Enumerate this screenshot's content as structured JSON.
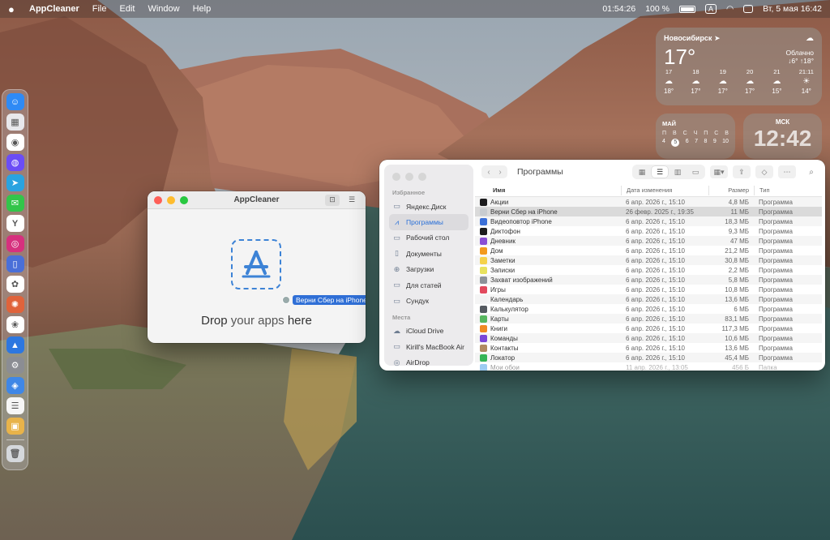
{
  "menubar": {
    "app_name": "AppCleaner",
    "items": [
      "File",
      "Edit",
      "Window",
      "Help"
    ],
    "record_time": "01:54:26",
    "battery": "100 %",
    "input_source": "A",
    "datetime": "Вт, 5 мая  16:42"
  },
  "dock": {
    "apps": [
      {
        "name": "finder-icon",
        "color": "#2f8af5",
        "glyph": "☺"
      },
      {
        "name": "launchpad-icon",
        "color": "#e8e8ec",
        "glyph": "▦"
      },
      {
        "name": "chrome-icon",
        "color": "#ffffff",
        "glyph": "◉"
      },
      {
        "name": "messenger-icon",
        "color": "#6b4df6",
        "glyph": "◍"
      },
      {
        "name": "telegram-icon",
        "color": "#2aa3e0",
        "glyph": "➤"
      },
      {
        "name": "messages-icon",
        "color": "#33c54a",
        "glyph": "✉"
      },
      {
        "name": "yandex-browser-icon",
        "color": "#ffffff",
        "glyph": "Y"
      },
      {
        "name": "instagram-icon",
        "color": "#d6307e",
        "glyph": "◎"
      },
      {
        "name": "phone-mirroring-icon",
        "color": "#4a6fd8",
        "glyph": "▯"
      },
      {
        "name": "chatgpt-icon",
        "color": "#ffffff",
        "glyph": "✿"
      },
      {
        "name": "claude-icon",
        "color": "#e0633b",
        "glyph": "✺"
      },
      {
        "name": "photos-icon",
        "color": "#ffffff",
        "glyph": "❀"
      },
      {
        "name": "keynote-icon",
        "color": "#2d77e0",
        "glyph": "▲"
      },
      {
        "name": "system-settings-icon",
        "color": "#8b8d93",
        "glyph": "⚙"
      },
      {
        "name": "cleaner-icon",
        "color": "#3f87e6",
        "glyph": "◈"
      },
      {
        "name": "notes-icon",
        "color": "#f6f6f6",
        "glyph": "☰"
      },
      {
        "name": "preview-icon",
        "color": "#e8b34a",
        "glyph": "▣"
      }
    ],
    "trash": {
      "name": "trash-icon",
      "color": "#d5d8dc",
      "glyph": "🗑"
    }
  },
  "weather": {
    "city": "Новосибирск",
    "temp": "17°",
    "condition": "Облачно",
    "range": "↓6° ↑18°",
    "hours": [
      {
        "time": "17",
        "temp": "18°",
        "icon": "☁"
      },
      {
        "time": "18",
        "temp": "17°",
        "icon": "☁"
      },
      {
        "time": "19",
        "temp": "17°",
        "icon": "☁"
      },
      {
        "time": "20",
        "temp": "17°",
        "icon": "☁"
      },
      {
        "time": "21",
        "temp": "15°",
        "icon": "☁"
      },
      {
        "time": "21:11",
        "temp": "14°",
        "icon": "☀"
      }
    ]
  },
  "calendar": {
    "month": "МАЙ",
    "weekdays": [
      "П",
      "В",
      "С",
      "Ч",
      "П",
      "С",
      "В"
    ],
    "dates": [
      "4",
      "5",
      "6",
      "7",
      "8",
      "9",
      "10"
    ],
    "today": "5"
  },
  "clock": {
    "label": "МСК",
    "time": "12:42"
  },
  "appcleaner": {
    "title": "AppCleaner",
    "drop_prefix": "Drop",
    "drop_middle": " your apps ",
    "drop_suffix": "here",
    "drag_label": "Верни Сбер на iPhone"
  },
  "finder": {
    "title": "Программы",
    "sidebar": {
      "favorites_header": "Избранное",
      "favorites": [
        {
          "label": "Яндекс.Диск",
          "icon": "folder-icon",
          "glyph": "▭"
        },
        {
          "label": "Программы",
          "icon": "applications-icon",
          "glyph": "⩘",
          "active": true
        },
        {
          "label": "Рабочий стол",
          "icon": "desktop-icon",
          "glyph": "▭"
        },
        {
          "label": "Документы",
          "icon": "document-icon",
          "glyph": "▯"
        },
        {
          "label": "Загрузки",
          "icon": "downloads-icon",
          "glyph": "⊕"
        },
        {
          "label": "Для статей",
          "icon": "folder-icon",
          "glyph": "▭"
        },
        {
          "label": "Сундук",
          "icon": "folder-icon",
          "glyph": "▭"
        }
      ],
      "locations_header": "Места",
      "locations": [
        {
          "label": "iCloud Drive",
          "icon": "icloud-icon",
          "glyph": "☁"
        },
        {
          "label": "Kirill's MacBook Air",
          "icon": "laptop-icon",
          "glyph": "▭"
        },
        {
          "label": "AirDrop",
          "icon": "airdrop-icon",
          "glyph": "◎"
        }
      ]
    },
    "columns": {
      "name": "Имя",
      "date": "Дата изменения",
      "size": "Размер",
      "kind": "Тип"
    },
    "rows": [
      {
        "name": "Акции",
        "date": "6 апр. 2026 г., 15:10",
        "size": "4,8 МБ",
        "kind": "Программа",
        "color": "#1c1c1e"
      },
      {
        "name": "Верни Сбер на iPhone",
        "date": "26 февр. 2025 г., 19:35",
        "size": "11 МБ",
        "kind": "Программа",
        "color": "#c8ccd0"
      },
      {
        "name": "Видеоповтор iPhone",
        "date": "6 апр. 2026 г., 15:10",
        "size": "18,3 МБ",
        "kind": "Программа",
        "color": "#3a6fd8"
      },
      {
        "name": "Диктофон",
        "date": "6 апр. 2026 г., 15:10",
        "size": "9,3 МБ",
        "kind": "Программа",
        "color": "#1c1c1e"
      },
      {
        "name": "Дневник",
        "date": "6 апр. 2026 г., 15:10",
        "size": "47 МБ",
        "kind": "Программа",
        "color": "#8a4fd6"
      },
      {
        "name": "Дом",
        "date": "6 апр. 2026 г., 15:10",
        "size": "21,2 МБ",
        "kind": "Программа",
        "color": "#f39a1e"
      },
      {
        "name": "Заметки",
        "date": "6 апр. 2026 г., 15:10",
        "size": "30,8 МБ",
        "kind": "Программа",
        "color": "#f5d24a"
      },
      {
        "name": "Записки",
        "date": "6 апр. 2026 г., 15:10",
        "size": "2,2 МБ",
        "kind": "Программа",
        "color": "#e8e25e"
      },
      {
        "name": "Захват изображений",
        "date": "6 апр. 2026 г., 15:10",
        "size": "5,8 МБ",
        "kind": "Программа",
        "color": "#8d9299"
      },
      {
        "name": "Игры",
        "date": "6 апр. 2026 г., 15:10",
        "size": "10,8 МБ",
        "kind": "Программа",
        "color": "#e2495d"
      },
      {
        "name": "Календарь",
        "date": "6 апр. 2026 г., 15:10",
        "size": "13,6 МБ",
        "kind": "Программа",
        "color": "#f2f2f2"
      },
      {
        "name": "Калькулятор",
        "date": "6 апр. 2026 г., 15:10",
        "size": "6 МБ",
        "kind": "Программа",
        "color": "#555a60"
      },
      {
        "name": "Карты",
        "date": "6 апр. 2026 г., 15:10",
        "size": "83,1 МБ",
        "kind": "Программа",
        "color": "#57b65f"
      },
      {
        "name": "Книги",
        "date": "6 апр. 2026 г., 15:10",
        "size": "117,3 МБ",
        "kind": "Программа",
        "color": "#f08a24"
      },
      {
        "name": "Команды",
        "date": "6 апр. 2026 г., 15:10",
        "size": "10,6 МБ",
        "kind": "Программа",
        "color": "#7a46d8"
      },
      {
        "name": "Контакты",
        "date": "6 апр. 2026 г., 15:10",
        "size": "13,6 МБ",
        "kind": "Программа",
        "color": "#b08a62"
      },
      {
        "name": "Локатор",
        "date": "6 апр. 2026 г., 15:10",
        "size": "45,4 МБ",
        "kind": "Программа",
        "color": "#36b557"
      },
      {
        "name": "Мои обои",
        "date": "11 апр. 2026 г., 13:05",
        "size": "456 Б",
        "kind": "Папка",
        "color": "#3d9ae6"
      }
    ]
  }
}
